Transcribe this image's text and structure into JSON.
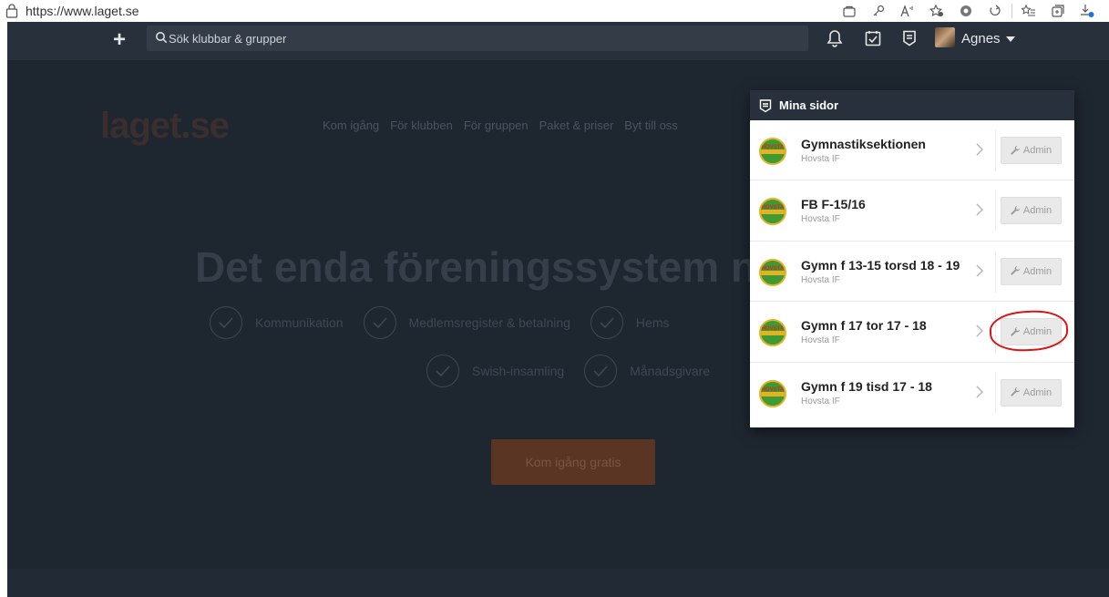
{
  "browser": {
    "url": "https://www.laget.se"
  },
  "topnav": {
    "search_placeholder": "Sök klubbar & grupper",
    "username": "Agnes"
  },
  "hero": {
    "logo": "laget.se",
    "menu": [
      "Kom igång",
      "För klubben",
      "För gruppen",
      "Paket & priser",
      "Byt till oss"
    ],
    "title": "Det enda föreningssystem n",
    "features_row1": [
      "Kommunikation",
      "Medlemsregister & betalning",
      "Hems"
    ],
    "features_row2": [
      "Swish-insamling",
      "Månadsgivare"
    ],
    "cta": "Kom igång gratis"
  },
  "dropdown": {
    "title": "Mina sidor",
    "admin_label": "Admin",
    "items": [
      {
        "name": "Gymnastiksektionen",
        "club": "Hovsta IF"
      },
      {
        "name": "FB F-15/16",
        "club": "Hovsta IF"
      },
      {
        "name": "Gymn f 13-15 torsd 18 - 19",
        "club": "Hovsta IF"
      },
      {
        "name": "Gymn f 17 tor 17 - 18",
        "club": "Hovsta IF"
      },
      {
        "name": "Gymn f 19 tisd 17 - 18",
        "club": "Hovsta IF"
      }
    ]
  },
  "colors": {
    "accent": "#e4512a",
    "nav_bg": "#27303b",
    "annotation": "#d91515"
  }
}
